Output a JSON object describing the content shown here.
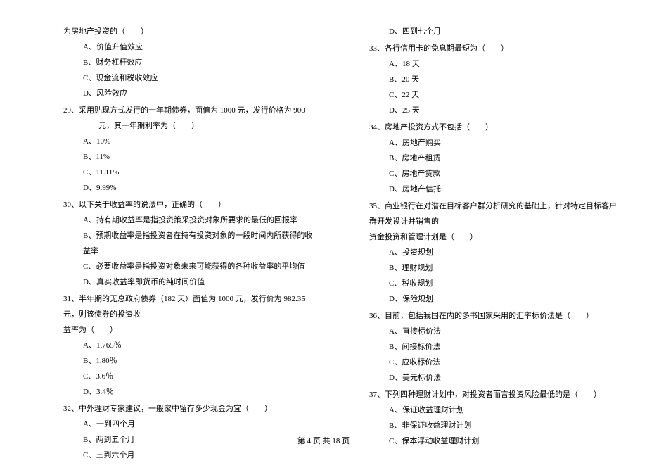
{
  "left": {
    "fragment_top": "为房地产投资的（　　）",
    "q28_options": [
      "A、价值升值效应",
      "B、财务杠杆效应",
      "C、现金流和税收效应",
      "D、风险效应"
    ],
    "q29_stem": "29、采用贴现方式发行的一年期债券，面值为 1000 元，发行价格为 900 元，其一年期利率为（　　）",
    "q29_options": [
      "A、10%",
      "B、11%",
      "C、11.11%",
      "D、9.99%"
    ],
    "q30_stem": "30、以下关于收益率的说法中，正确的（　　）",
    "q30_options": [
      "A、持有期收益率是指投资策采投资对象所要求的最低的回报率",
      "B、预期收益率是指投资者在持有投资对象的一段时间内所获得的收益率",
      "C、必要收益率是指投资对象未来可能获得的各种收益率的平均值",
      "D、真实收益率即货币的纯时间价值"
    ],
    "q31_stem_line1": "31、半年期的无息政府债券（182 天）面值为 1000 元，发行价为 982.35 元，则该债券的投资收",
    "q31_stem_line2": "益率为（　　）",
    "q31_options": [
      "A、1.765％",
      "B、1.80％",
      "C、3.6％",
      "D、3.4％"
    ],
    "q32_stem": "32、中外理财专家建议，一般家中留存多少现金为宜（　　）",
    "q32_options": [
      "A、一到四个月",
      "B、两到五个月",
      "C、三到六个月"
    ]
  },
  "right": {
    "fragment_option": "D、四到七个月",
    "q33_stem": "33、各行信用卡的免息期最短为（　　）",
    "q33_options": [
      "A、18 天",
      "B、20 天",
      "C、22 天",
      "D、25 天"
    ],
    "q34_stem": "34、房地产投资方式不包括（　　）",
    "q34_options": [
      "A、房地产购买",
      "B、房地产租赁",
      "C、房地产贷款",
      "D、房地产信托"
    ],
    "q35_stem_line1": "35、商业银行在对潜在目标客户群分析研究的基础上，针对特定目标客户群开发设计并销售的",
    "q35_stem_line2": "资金投资和管理计划是（　　）",
    "q35_options": [
      "A、投资规划",
      "B、理财规划",
      "C、税收规划",
      "D、保险规划"
    ],
    "q36_stem": "36、目前，包括我国在内的多书国家采用的汇率标价法是（　　）",
    "q36_options": [
      "A、直接标价法",
      "B、间接标价法",
      "C、应收标价法",
      "D、美元标价法"
    ],
    "q37_stem": "37、下列四种理财计划中，对投资者而言投资风险最低的是（　　）",
    "q37_options": [
      "A、保证收益理财计划",
      "B、非保证收益理财计划",
      "C、保本浮动收益理财计划"
    ]
  },
  "footer": "第 4 页 共 18 页"
}
